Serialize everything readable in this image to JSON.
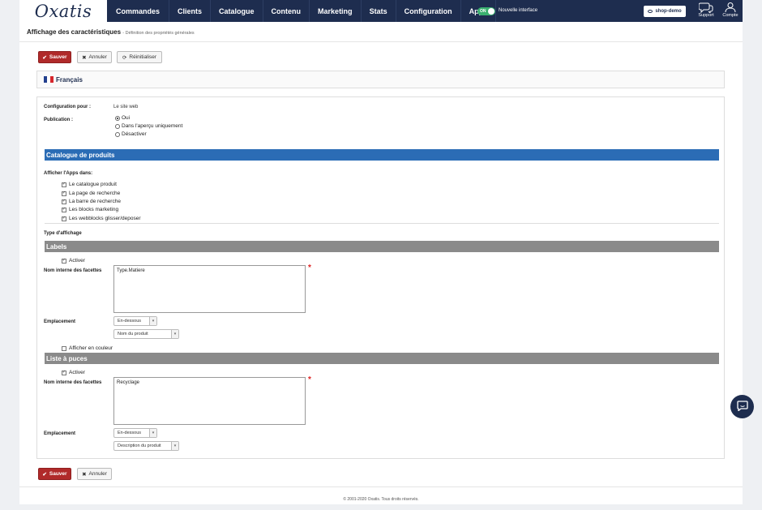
{
  "nav": {
    "logo": "Oxatis",
    "items": [
      "Commandes",
      "Clients",
      "Catalogue",
      "Contenu",
      "Marketing",
      "Stats",
      "Configuration",
      "Apps"
    ],
    "toggle_label": "ON",
    "new_interface": "Nouvelle interface",
    "shop_button": "shop-demo",
    "support": "Support",
    "account": "Compte"
  },
  "header": {
    "title": "Affichage des caractéristiques",
    "subtitle": "- Définition des propriétés générales"
  },
  "actions": {
    "save": "Sauver",
    "cancel": "Annuler",
    "reset": "Réinitialiser"
  },
  "language": "Français",
  "config": {
    "config_for_label": "Configuration pour :",
    "config_for_value": "Le site web",
    "publication_label": "Publication :",
    "publication_options": [
      "Oui",
      "Dans l'aperçu uniquement",
      "Désactiver"
    ],
    "publication_selected": "Oui"
  },
  "catalogue": {
    "title": "Catalogue de produits",
    "show_in_label": "Afficher l'Apps dans:",
    "show_in": [
      {
        "label": "Le catalogue produit",
        "checked": true
      },
      {
        "label": "La page de recherche",
        "checked": true
      },
      {
        "label": "La barre de recherche",
        "checked": true
      },
      {
        "label": "Les blocks marketing",
        "checked": true
      },
      {
        "label": "Les webblocks glisser/deposer",
        "checked": true
      }
    ],
    "display_type_label": "Type d'affichage"
  },
  "labels_section": {
    "title": "Labels",
    "activate": "Activer",
    "facet_label": "Nom interne des facettes",
    "facet_value": "Type.Matiere",
    "placement_label": "Emplacement",
    "placement_value": "En-dessous",
    "field_value": "Nom du produit",
    "color_label": "Afficher en couleur"
  },
  "bullets_section": {
    "title": "Liste à puces",
    "activate": "Activer",
    "facet_label": "Nom interne des facettes",
    "facet_value": "Recyclage",
    "placement_label": "Emplacement",
    "placement_value": "En-dessous",
    "field_value": "Description du produit"
  },
  "required_mark": "*",
  "footer": "© 2001-2020 Oxatis. Tous droits réservés.",
  "colors": {
    "nav_bg": "#1e2d4f",
    "save_btn": "#b02a2a",
    "section_blue": "#2b6cb5",
    "section_grey": "#8a8a8a",
    "toggle_on": "#3ab06f"
  }
}
